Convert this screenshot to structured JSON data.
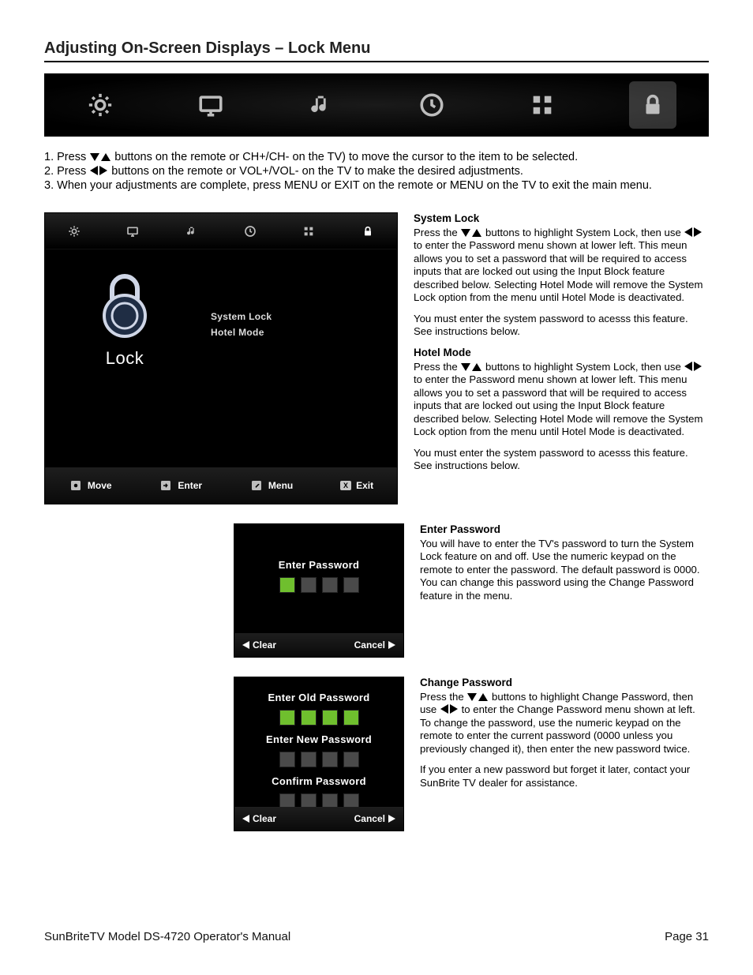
{
  "heading": "Adjusting On-Screen Displays – Lock Menu",
  "strip_icons": [
    "gear-icon",
    "display-icon",
    "music-icon",
    "clock-icon",
    "apps-icon",
    "lock-icon"
  ],
  "instructions": {
    "i1a": "Press ",
    "i1b": " buttons on the remote or CH+/CH- on the TV) to move the cursor to the item to be selected.",
    "i2a": "Press ",
    "i2b": " buttons on the remote or VOL+/VOL- on the TV to make the desired adjustments.",
    "i3": "When your adjustments are complete, press MENU or EXIT on the remote or MENU on the TV to exit the main menu."
  },
  "lock_screenshot": {
    "title": "Lock",
    "menu": [
      "System Lock",
      "Hotel Mode"
    ],
    "footer": {
      "move": "Move",
      "enter": "Enter",
      "menu": "Menu",
      "exit": "Exit",
      "exit_key": "X"
    }
  },
  "sections": {
    "system_lock": {
      "title": "System Lock",
      "p1a": "Press the ",
      "p1b": " buttons to highlight System Lock, then use ",
      "p1c": " to enter the Password menu shown at lower left. This meun allows you to set a password that will be required to access inputs that are locked out using the Input Block feature described below. Selecting Hotel Mode will remove the System Lock option from the menu until Hotel Mode is deactivated.",
      "p2": "You must enter the  system password to acesss this feature. See instructions below."
    },
    "hotel_mode": {
      "title": "Hotel Mode",
      "p1a": "Press the ",
      "p1b": " buttons to highlight System Lock, then use ",
      "p1c": " to enter the Password menu shown at lower left. This menu allows you to set a password that will be required to access inputs that are locked out using the Input Block feature described below. Selecting Hotel Mode will remove the System Lock option from the menu until Hotel Mode is deactivated.",
      "p2": "You must enter the  system password to acesss this feature. See instructions below."
    },
    "enter_password": {
      "title": "Enter Password",
      "p1": "You will have to enter the TV's password to turn the System Lock feature on and off. Use the numeric keypad on the remote to enter the password. The default password is 0000. You can change this password using the Change Password feature in the menu."
    },
    "change_password": {
      "title": "Change Password",
      "p1a": "Press the ",
      "p1b": " buttons to highlight Change Password, then use ",
      "p1c": " to enter the Change Password menu shown at left.  To change the password, use the numeric keypad on the remote to enter the current password (0000 unless you previously changed it), then enter the new password twice.",
      "p2": "If you enter a new password but forget it later, contact your SunBrite TV dealer for assistance."
    }
  },
  "dialogs": {
    "enter_title": "Enter Password",
    "old_title": "Enter Old Password",
    "new_title": "Enter New Password",
    "confirm_title": "Confirm Password",
    "clear": "Clear",
    "cancel": "Cancel"
  },
  "footer": {
    "left": "SunBriteTV Model DS-4720 Operator's Manual",
    "right": "Page 31"
  }
}
